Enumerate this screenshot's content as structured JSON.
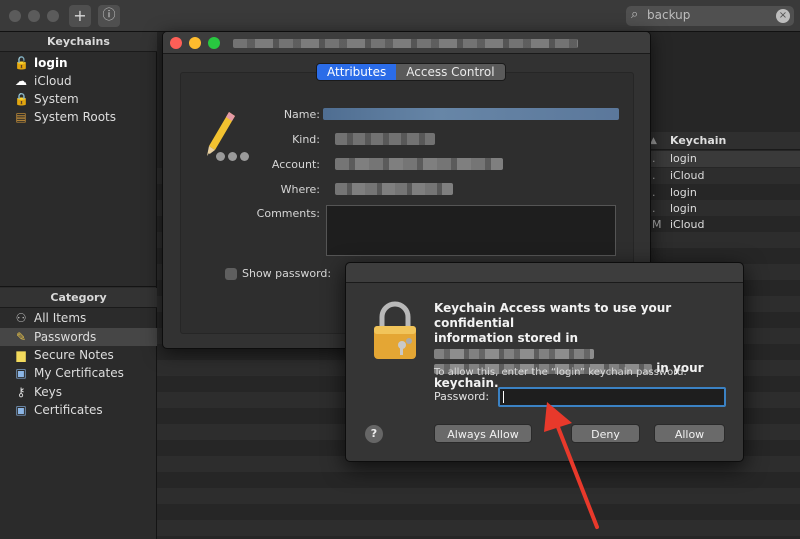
{
  "toolbar": {
    "add_glyph": "+",
    "info_glyph": "ⓘ",
    "search_query": "backup",
    "clear_glyph": "×"
  },
  "sidebar": {
    "keychains_header": "Keychains",
    "keychains": [
      {
        "label": "login",
        "icon": "unlocked-padlock-icon"
      },
      {
        "label": "iCloud",
        "icon": "cloud-icon"
      },
      {
        "label": "System",
        "icon": "padlock-icon"
      },
      {
        "label": "System Roots",
        "icon": "cabinet-icon"
      }
    ],
    "category_header": "Category",
    "categories": [
      {
        "label": "All Items",
        "icon": "people-icon"
      },
      {
        "label": "Passwords",
        "icon": "pencil-icon"
      },
      {
        "label": "Secure Notes",
        "icon": "note-icon"
      },
      {
        "label": "My Certificates",
        "icon": "certificate-icon"
      },
      {
        "label": "Keys",
        "icon": "key-icon"
      },
      {
        "label": "Certificates",
        "icon": "certificate-icon"
      }
    ]
  },
  "list": {
    "column_header": "Keychain",
    "rows": [
      {
        "prefix": ".",
        "keychain": "login"
      },
      {
        "prefix": ".",
        "keychain": "iCloud"
      },
      {
        "prefix": ".",
        "keychain": "login"
      },
      {
        "prefix": ".",
        "keychain": "login"
      },
      {
        "prefix": "M",
        "keychain": "iCloud"
      }
    ]
  },
  "attributes_window": {
    "tabs": [
      "Attributes",
      "Access Control"
    ],
    "fields": {
      "name_label": "Name:",
      "kind_label": "Kind:",
      "account_label": "Account:",
      "where_label": "Where:",
      "comments_label": "Comments:"
    },
    "show_password_label": "Show password:"
  },
  "dialog": {
    "message_line1": "Keychain Access wants to use your confidential",
    "message_line2": "information stored in",
    "message_line3": "in your",
    "message_line4": "keychain.",
    "sub_message": "To allow this, enter the “login” keychain password.",
    "password_label": "Password:",
    "password_value": "",
    "help_glyph": "?",
    "buttons": {
      "always_allow": "Always Allow",
      "deny": "Deny",
      "allow": "Allow"
    }
  },
  "colors": {
    "accent": "#2b6ce8",
    "arrow": "#e8392b",
    "focus_ring": "#3b82c4"
  }
}
